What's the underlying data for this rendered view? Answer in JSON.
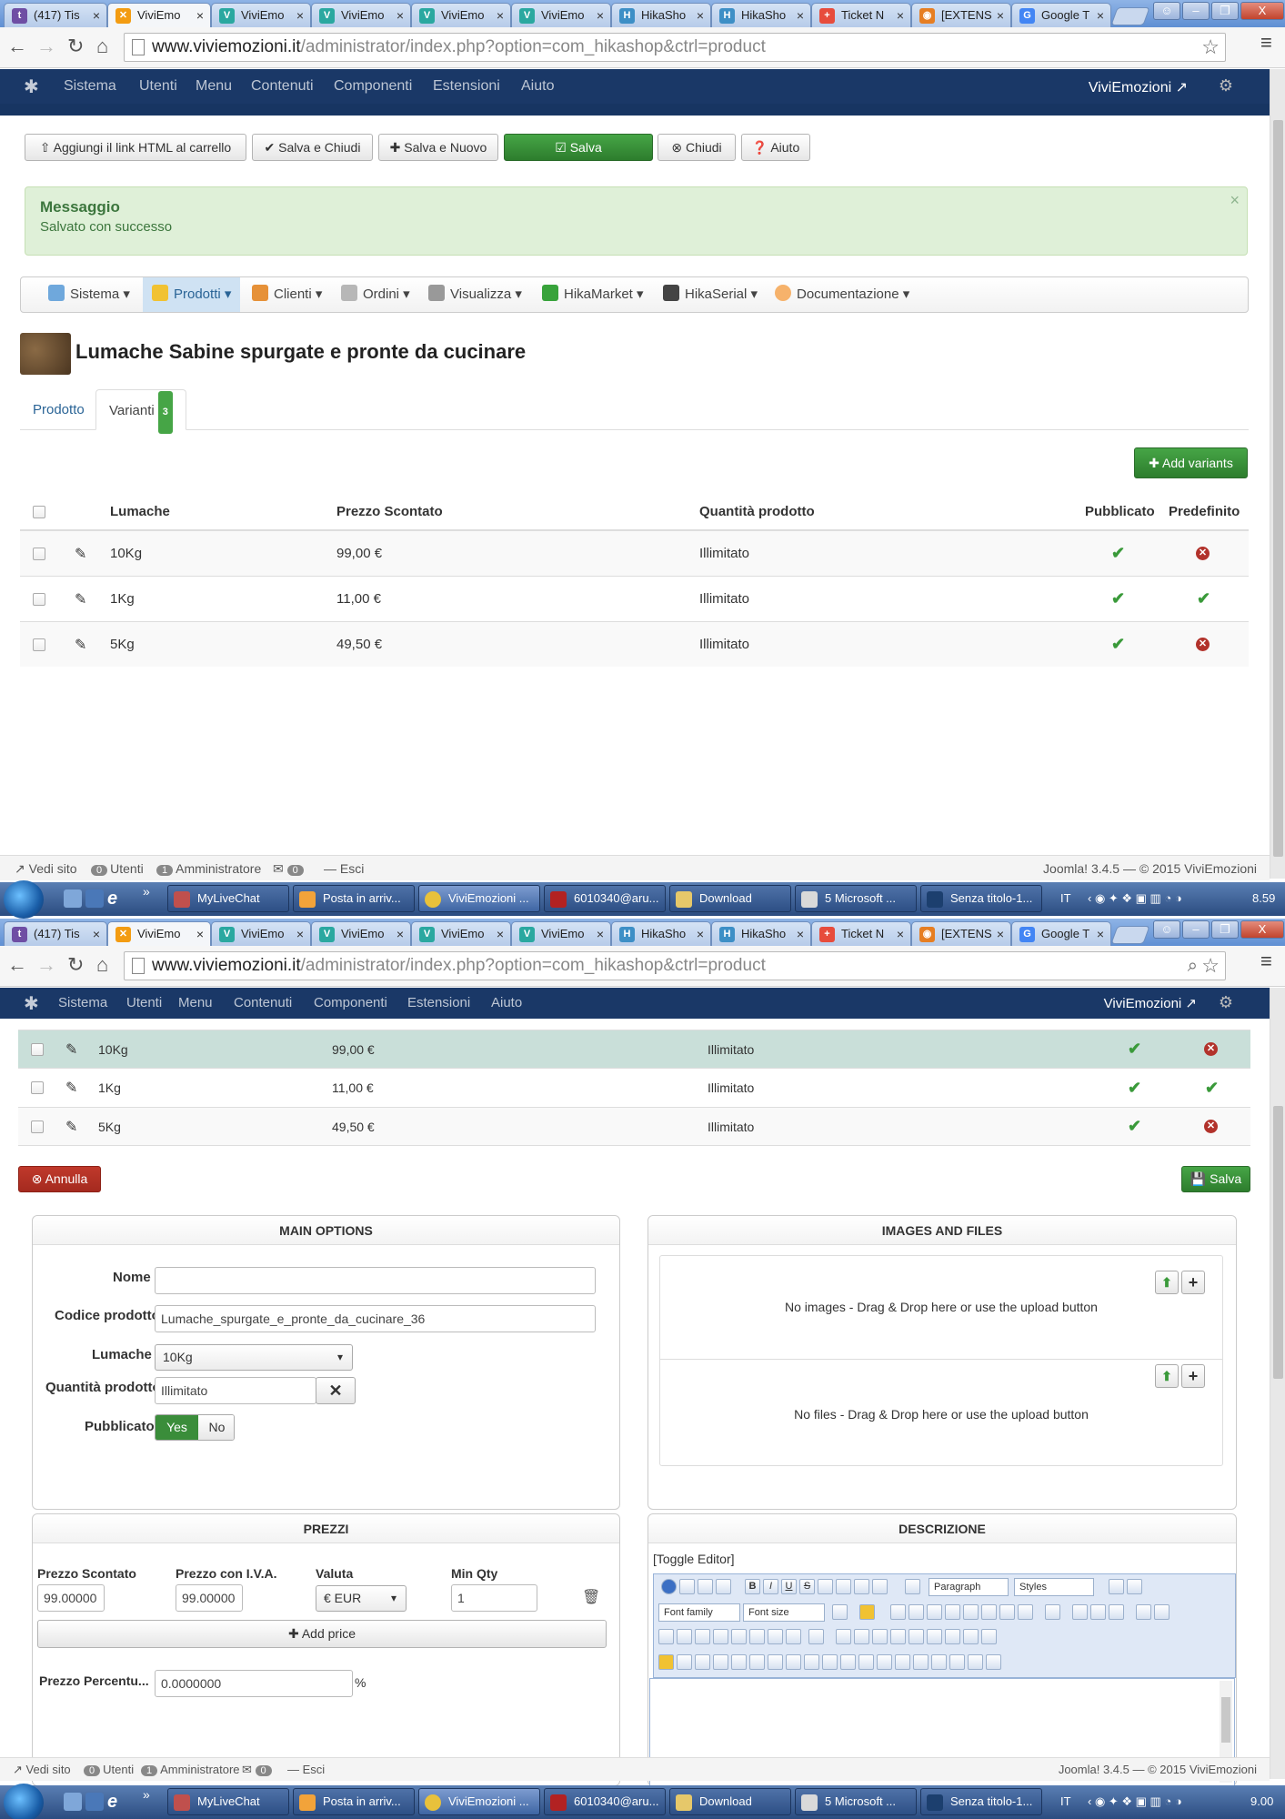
{
  "browser": {
    "tabs": [
      {
        "label": "(417) Tis",
        "icon": "tumblr-icon",
        "color": "#6f4ea4"
      },
      {
        "label": "ViviEmo",
        "icon": "joomla-icon",
        "color": "#f39c12",
        "active": true
      },
      {
        "label": "ViviEmo",
        "icon": "vivi-icon",
        "color": "#2aa8a0"
      },
      {
        "label": "ViviEmo",
        "icon": "vivi-icon",
        "color": "#2aa8a0"
      },
      {
        "label": "ViviEmo",
        "icon": "vivi-icon",
        "color": "#2aa8a0"
      },
      {
        "label": "ViviEmo",
        "icon": "vivi-icon",
        "color": "#2aa8a0"
      },
      {
        "label": "HikaSho",
        "icon": "hika-icon",
        "color": "#3d8fc6"
      },
      {
        "label": "HikaSho",
        "icon": "hika-icon",
        "color": "#3d8fc6"
      },
      {
        "label": "Ticket N",
        "icon": "ticket-icon",
        "color": "#e74c3c"
      },
      {
        "label": "[EXTENS",
        "icon": "extens-icon",
        "color": "#e67e22"
      },
      {
        "label": "Google T",
        "icon": "google-translate-icon",
        "color": "#4285f4"
      }
    ],
    "url_host": "www.viviemozioni.it",
    "url_path": "/administrator/index.php?option=com_hikashop&ctrl=product"
  },
  "joomla_bar": {
    "items": [
      "Sistema",
      "Utenti",
      "Menu",
      "Contenuti",
      "Componenti",
      "Estensioni",
      "Aiuto"
    ],
    "site": "ViviEmozioni ↗"
  },
  "toolbar": {
    "add_link": "⇧ Aggiungi il link HTML al carrello",
    "save_close": "✔ Salva e Chiudi",
    "save_new": "✚ Salva e Nuovo",
    "save": "☑ Salva",
    "close": "⊗ Chiudi",
    "help": "❓ Aiuto"
  },
  "message": {
    "title": "Messaggio",
    "text": "Salvato con successo"
  },
  "hikanav": [
    "Sistema ▾",
    "Prodotti ▾",
    "Clienti ▾",
    "Ordini ▾",
    "Visualizza ▾",
    "HikaMarket ▾",
    "HikaSerial ▾",
    "Documentazione ▾"
  ],
  "product": {
    "title": "Lumache Sabine spurgate e pronte da cucinare"
  },
  "tabs": {
    "prodotto": "Prodotto",
    "varianti": "Varianti",
    "varianti_count": "3"
  },
  "add_variants": "✚ Add variants",
  "variants_table": {
    "headers": [
      "Lumache",
      "Prezzo Scontato",
      "Quantità prodotto",
      "Pubblicato",
      "Predefinito"
    ],
    "rows": [
      {
        "name": "10Kg",
        "price": "99,00 €",
        "qty": "Illimitato",
        "published": true,
        "default": false
      },
      {
        "name": "1Kg",
        "price": "11,00 €",
        "qty": "Illimitato",
        "published": true,
        "default": true
      },
      {
        "name": "5Kg",
        "price": "49,50 €",
        "qty": "Illimitato",
        "published": true,
        "default": false
      }
    ]
  },
  "statusbar": {
    "view_site": "Vedi sito",
    "users_count": "0",
    "users": "Utenti",
    "admins_count": "1",
    "admins": "Amministratore",
    "mail_count": "0",
    "logout": "Esci",
    "version": "Joomla! 3.4.5 — © 2015 ViviEmozioni"
  },
  "taskbar": {
    "buttons": [
      "MyLiveChat",
      "Posta in arriv...",
      "ViviEmozioni ...",
      "6010340@aru...",
      "Download",
      "5 Microsoft ...",
      "Senza titolo-1..."
    ],
    "lang": "IT",
    "time1": "8.59",
    "time2": "9.00"
  },
  "edit": {
    "cancel": "⊗ Annulla",
    "save": "💾 Salva",
    "main_options": {
      "title": "MAIN OPTIONS",
      "nome_label": "Nome",
      "nome_value": "",
      "codice_label": "Codice prodotto",
      "codice_value": "Lumache_spurgate_e_pronte_da_cucinare_36",
      "lumache_label": "Lumache",
      "lumache_value": "10Kg",
      "qty_label": "Quantità prodotto",
      "qty_value": "Illimitato",
      "pub_label": "Pubblicato",
      "yes": "Yes",
      "no": "No"
    },
    "images_files": {
      "title": "IMAGES AND FILES",
      "no_images": "No images - Drag & Drop here or use the upload button",
      "no_files": "No files - Drag & Drop here or use the upload button"
    },
    "prezzi": {
      "title": "PREZZI",
      "col_scontato": "Prezzo Scontato",
      "col_iva": "Prezzo con I.V.A.",
      "col_valuta": "Valuta",
      "col_minqty": "Min Qty",
      "scontato": "99.00000",
      "iva": "99.00000",
      "valuta": "€ EUR",
      "minqty": "1",
      "add_price": "✚ Add price",
      "percent_label": "Prezzo Percentu...",
      "percent_value": "0.0000000",
      "percent_unit": "%"
    },
    "descrizione": {
      "title": "DESCRIZIONE",
      "toggle": "[Toggle Editor]",
      "paragraph": "Paragraph",
      "styles": "Styles",
      "font_family": "Font family",
      "font_size": "Font size"
    }
  }
}
